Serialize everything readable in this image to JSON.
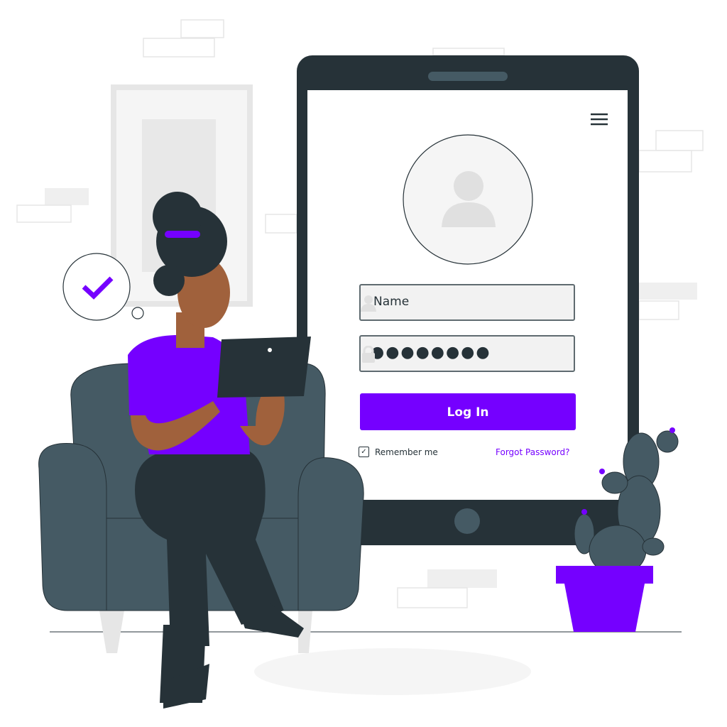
{
  "login_form": {
    "name_placeholder": "Name",
    "password_value": "●●●●●●●●",
    "login_button": "Log In",
    "remember_label": "Remember me",
    "remember_checked": true,
    "forgot_link": "Forgot Password?"
  },
  "icons": {
    "menu": "hamburger-menu-icon",
    "avatar": "user-avatar-icon",
    "name_field": "user-icon",
    "password_field": "lock-icon",
    "thought": "checkmark-icon"
  },
  "colors": {
    "accent": "#7500ff",
    "device": "#263238",
    "chair": "#455a64",
    "skin": "#a0613c"
  }
}
